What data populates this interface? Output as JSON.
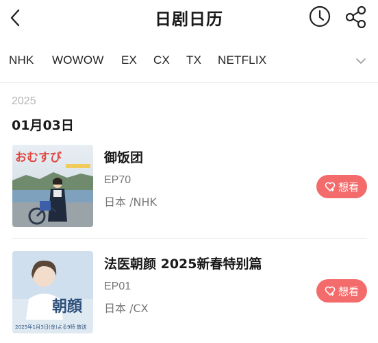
{
  "header": {
    "title": "日剧日历",
    "back_icon": "chevron-left-icon",
    "history_icon": "clock-icon",
    "share_icon": "share-icon"
  },
  "tabs": [
    {
      "label": "NHK"
    },
    {
      "label": "WOWOW"
    },
    {
      "label": "EX"
    },
    {
      "label": "CX"
    },
    {
      "label": "TX"
    },
    {
      "label": "NETFLIX"
    }
  ],
  "tabs_more_icon": "chevron-down-icon",
  "year": "2025",
  "date": "01月03日",
  "shows": [
    {
      "title": "御饭团",
      "episode": "EP70",
      "meta": "日本 /NHK",
      "want_label": "想看",
      "poster": {
        "logo_text": "おむすび"
      }
    },
    {
      "title": "法医朝颜 2025新春特别篇",
      "episode": "EP01",
      "meta": "日本 /CX",
      "want_label": "想看",
      "poster": {
        "logo_text": "朝顔",
        "caption": "2025年1月3日(金)よる9時 放送"
      }
    }
  ],
  "colors": {
    "accent": "#f46b6b",
    "title_text": "#1a1a1a",
    "secondary_text": "#777777",
    "year_text": "#b5b5b5"
  }
}
